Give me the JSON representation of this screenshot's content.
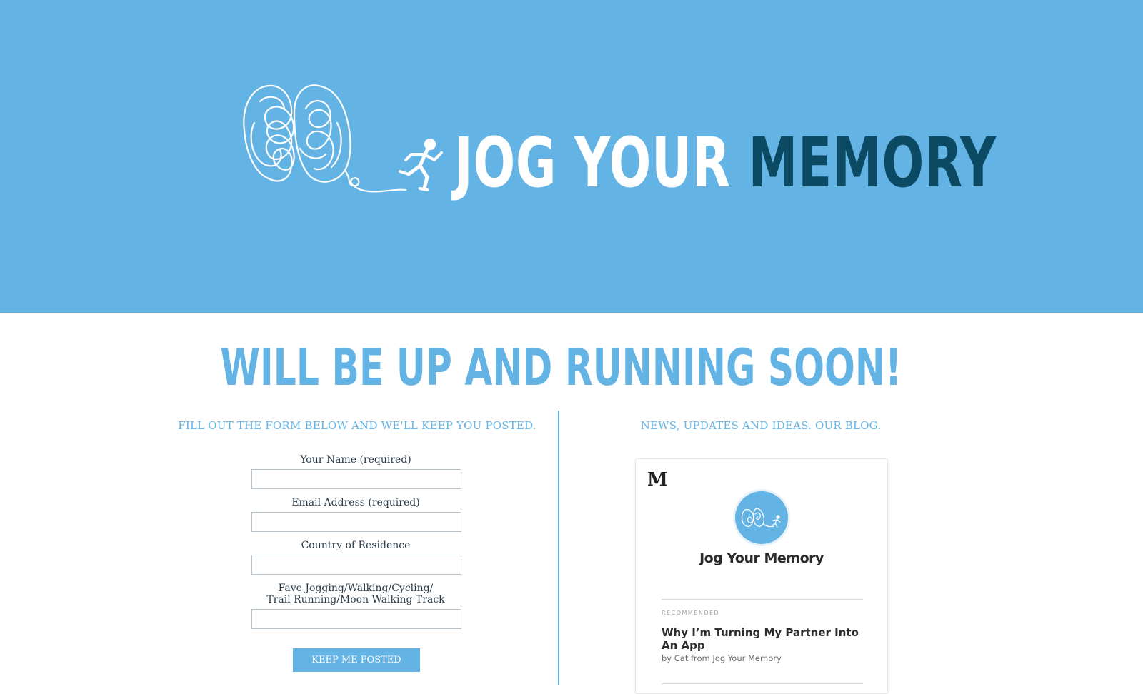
{
  "header": {
    "brand_part1": "JOG YOUR",
    "brand_part2": "MEMORY",
    "logo_icon": "brain-runner-logo-icon"
  },
  "colors": {
    "accent": "#63b3e5",
    "brand_dark": "#0c4a64",
    "text": "#2a3a48"
  },
  "main": {
    "headline": "WILL BE UP AND RUNNING SOON!"
  },
  "signup": {
    "title": "FILL OUT THE FORM BELOW AND WE'LL KEEP YOU POSTED.",
    "fields": [
      {
        "label": "Your Name (required)",
        "value": ""
      },
      {
        "label": "Email Address (required)",
        "value": ""
      },
      {
        "label": "Country of Residence",
        "value": ""
      },
      {
        "label_line1": "Fave Jogging/Walking/Cycling/",
        "label_line2": "Trail Running/Moon Walking Track",
        "value": ""
      }
    ],
    "submit_label": "KEEP ME POSTED"
  },
  "blog": {
    "title": "NEWS, UPDATES AND IDEAS. OUR BLOG.",
    "widget": {
      "platform_logo": "M",
      "publication_name": "Jog Your Memory",
      "section_label": "RECOMMENDED",
      "post_title": "Why I’m Turning My Partner Into An App",
      "post_byline": "by Cat from Jog Your Memory"
    }
  }
}
